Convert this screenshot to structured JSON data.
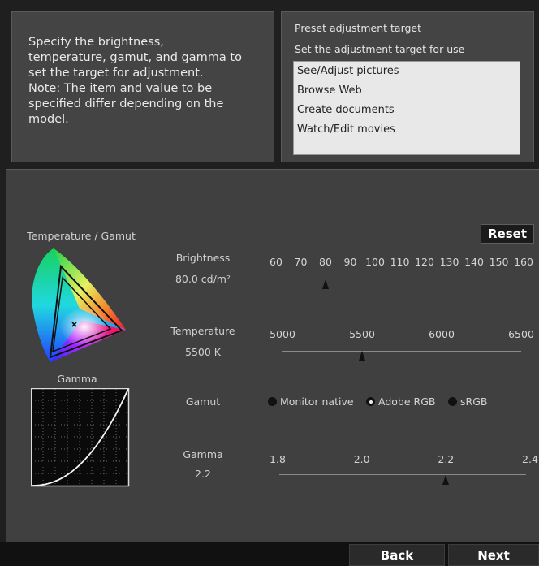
{
  "description": {
    "lines": [
      "Specify the brightness,",
      "temperature, gamut, and gamma to",
      "set the target for adjustment.",
      "Note: The item and value to be",
      "specified differ depending on the",
      "model."
    ]
  },
  "preset": {
    "title": "Preset adjustment target",
    "subtitle": "Set the adjustment target for use",
    "items": [
      "See/Adjust pictures",
      "Browse Web",
      "Create documents",
      "Watch/Edit movies"
    ]
  },
  "reset_label": "Reset",
  "temp_gamut_label": "Temperature / Gamut",
  "gamma_chart_label": "Gamma",
  "brightness": {
    "label": "Brightness",
    "value_text": "80.0 cd/m²",
    "ticks": [
      "60",
      "70",
      "80",
      "90",
      "100",
      "110",
      "120",
      "130",
      "140",
      "150",
      "160"
    ],
    "value": 80
  },
  "temperature": {
    "label": "Temperature",
    "value_text": "5500 K",
    "ticks": [
      "5000",
      "5500",
      "6000",
      "6500"
    ],
    "value": 5500
  },
  "gamut": {
    "label": "Gamut",
    "options": [
      "Monitor native",
      "Adobe RGB",
      "sRGB"
    ],
    "selected": "Adobe RGB"
  },
  "gamma": {
    "label": "Gamma",
    "value_text": "2.2",
    "ticks": [
      "1.8",
      "2.0",
      "2.2",
      "2.4"
    ],
    "value": 2.2
  },
  "nav": {
    "back": "Back",
    "next": "Next"
  }
}
